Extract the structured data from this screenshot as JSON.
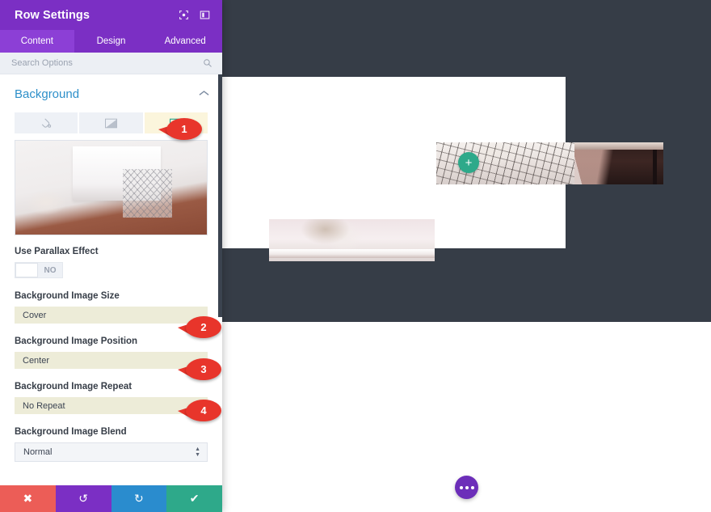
{
  "panel": {
    "title": "Row Settings",
    "header_icons": [
      {
        "name": "focus-target-icon",
        "glyph": "☉"
      },
      {
        "name": "layout-columns-icon",
        "glyph": "▥"
      }
    ],
    "tabs": [
      {
        "label": "Content",
        "active": true
      },
      {
        "label": "Design",
        "active": false
      },
      {
        "label": "Advanced",
        "active": false
      }
    ],
    "search": {
      "placeholder": "Search Options",
      "value": "",
      "icon": "search-icon"
    },
    "section": {
      "title": "Background",
      "collapse_icon": "chevron-up-icon"
    },
    "background_types": [
      {
        "name": "background-color-tab",
        "icon": "paint-drop-icon",
        "active": false
      },
      {
        "name": "background-gradient-tab",
        "icon": "gradient-icon",
        "active": false
      },
      {
        "name": "background-image-tab",
        "icon": "image-icon",
        "active": true
      }
    ],
    "fields": {
      "parallax": {
        "label": "Use Parallax Effect",
        "value": "NO"
      },
      "image_size": {
        "label": "Background Image Size",
        "value": "Cover"
      },
      "image_position": {
        "label": "Background Image Position",
        "value": "Center"
      },
      "image_repeat": {
        "label": "Background Image Repeat",
        "value": "No Repeat"
      },
      "image_blend": {
        "label": "Background Image Blend",
        "value": "Normal"
      }
    },
    "actions": [
      {
        "name": "discard-button",
        "icon": "close-icon",
        "glyph": "✖",
        "color": "#ec5d57"
      },
      {
        "name": "undo-button",
        "icon": "undo-icon",
        "glyph": "↺",
        "color": "#7b2fc4"
      },
      {
        "name": "redo-button",
        "icon": "redo-icon",
        "glyph": "↻",
        "color": "#2a8cce"
      },
      {
        "name": "save-button",
        "icon": "check-icon",
        "glyph": "✔",
        "color": "#2ea98a"
      }
    ]
  },
  "canvas": {
    "add_module_glyph": "+",
    "background_color": "#363d47"
  },
  "callouts": [
    {
      "number": "1"
    },
    {
      "number": "2"
    },
    {
      "number": "3"
    },
    {
      "number": "4"
    }
  ]
}
